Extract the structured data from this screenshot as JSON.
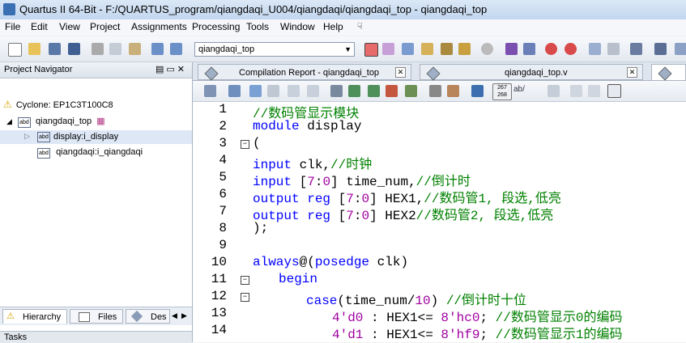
{
  "window": {
    "title": "Quartus II 64-Bit - F:/QUARTUS_program/qiangdaqi_U004/qiangdaqi/qiangdaqi_top - qiangdaqi_top"
  },
  "menu": [
    "File",
    "Edit",
    "View",
    "Project",
    "Assignments",
    "Processing",
    "Tools",
    "Window",
    "Help"
  ],
  "toolbar": {
    "entity_value": "qiangdaqi_top"
  },
  "navigator": {
    "title": "Project Navigator",
    "device": "Cyclone: EP1C3T100C8",
    "top_entity": "qiangdaqi_top",
    "children": [
      "display:i_display",
      "qiangdaqi:i_qiangdaqi"
    ],
    "tabs": [
      "Hierarchy",
      "Files",
      "Des"
    ],
    "tasks_label": "Tasks"
  },
  "editor": {
    "tabs": [
      {
        "label": "Compilation Report - qiangdaqi_top"
      },
      {
        "label": "qiangdaqi_top.v"
      }
    ],
    "line_numbers": [
      "1",
      "2",
      "3",
      "4",
      "5",
      "6",
      "7",
      "8",
      "9",
      "10",
      "11",
      "12",
      "13",
      "14"
    ],
    "code": {
      "l1": "//数码管显示模块",
      "l2a": "module",
      "l2b": " display",
      "l3": "(",
      "l4a": "input",
      "l4b": " clk,",
      "l4c": "//时钟",
      "l5a": "input",
      "l5b": " [",
      "l5c": "7",
      "l5d": ":",
      "l5e": "0",
      "l5f": "] time_num,",
      "l5g": "//倒计时",
      "l6a": "output",
      "l6b": " ",
      "l6c": "reg",
      "l6d": " [",
      "l6e": "7",
      "l6f": ":",
      "l6g": "0",
      "l6h": "] HEX1,",
      "l6i": "//数码管1, 段选,低亮",
      "l7a": "output",
      "l7b": " ",
      "l7c": "reg",
      "l7d": " [",
      "l7e": "7",
      "l7f": ":",
      "l7g": "0",
      "l7h": "] HEX2",
      "l7i": "//数码管2, 段选,低亮",
      "l8": ");",
      "l10a": "always",
      "l10b": "@(",
      "l10c": "posedge",
      "l10d": " clk)",
      "l11": "begin",
      "l12a": "case",
      "l12b": "(time_num/",
      "l12c": "10",
      "l12d": ") ",
      "l12e": "//倒计时十位",
      "l13a": "4'd0",
      "l13b": " : HEX1<= ",
      "l13c": "8'hc0",
      "l13d": "; ",
      "l13e": "//数码管显示0的编码",
      "l14a": "4'd1",
      "l14b": " : HEX1<= ",
      "l14c": "8'hf9",
      "l14d": "; ",
      "l14e": "//数码管显示1的编码"
    }
  },
  "icons": [
    "new-file-icon",
    "open-icon",
    "save-icon",
    "save-all-icon",
    "cut-icon",
    "copy-icon",
    "paste-icon",
    "undo-icon",
    "redo-icon",
    "compile-icon",
    "stop-icon",
    "programmer-icon",
    "warning-icon",
    "chip-icon"
  ]
}
